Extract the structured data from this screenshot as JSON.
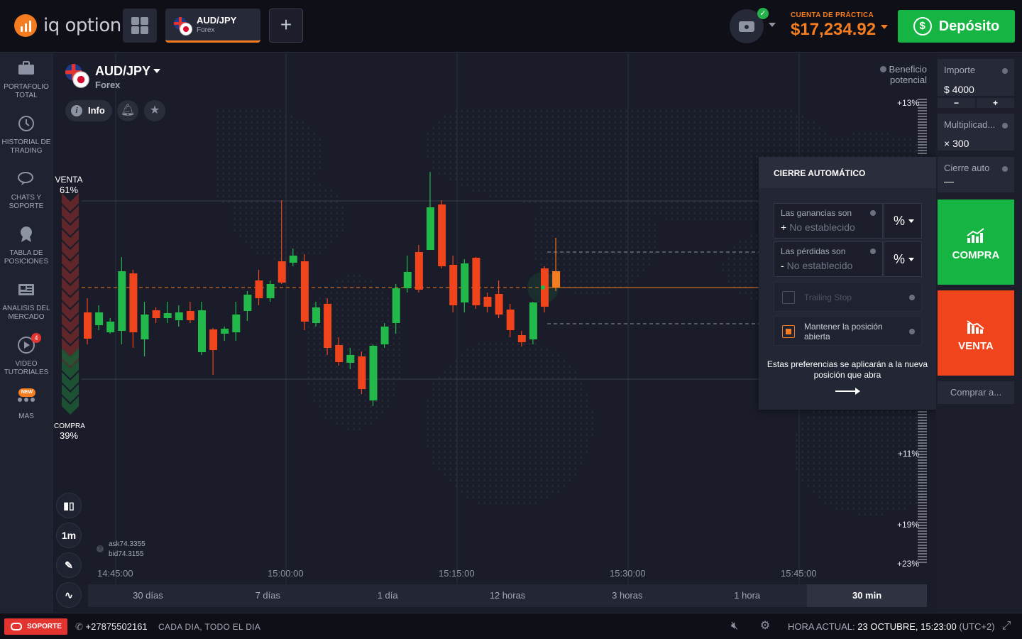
{
  "header": {
    "logo_text": "iq option",
    "asset_tab": {
      "name": "AUD/JPY",
      "type": "Forex"
    },
    "add_tab_label": "+",
    "account_label": "CUENTA DE PRÁCTICA",
    "balance": "$17,234.92",
    "deposit_label": "Depósito"
  },
  "sidebar": {
    "items": [
      {
        "label": "PORTAFOLIO TOTAL",
        "icon": "briefcase-icon"
      },
      {
        "label": "HISTORIAL DE TRADING",
        "icon": "history-icon"
      },
      {
        "label": "CHATS Y SOPORTE",
        "icon": "chat-icon"
      },
      {
        "label": "TABLA DE POSICIONES",
        "icon": "trophy-icon"
      },
      {
        "label": "ANALISIS DEL MERCADO",
        "icon": "news-icon"
      },
      {
        "label": "VIDEO TUTORIALES",
        "icon": "play-icon",
        "badge": "4"
      },
      {
        "label": "MAS",
        "icon": "more-icon",
        "badge": "NEW"
      }
    ]
  },
  "chart_header": {
    "asset": "AUD/JPY",
    "type": "Forex",
    "info_label": "Info"
  },
  "sentiment": {
    "sell_label": "VENTA",
    "sell_pct": "61%",
    "buy_label": "COMPRA",
    "buy_pct": "39%"
  },
  "tools": {
    "timeframe": "1m"
  },
  "quotes": {
    "ask": "ask74.3355",
    "bid": "bid74.3155"
  },
  "time_labels": [
    "14:45:00",
    "15:00:00",
    "15:15:00",
    "15:30:00",
    "15:45:00"
  ],
  "ranges": [
    {
      "label": "30 días",
      "active": false
    },
    {
      "label": "7 días",
      "active": false
    },
    {
      "label": "1 día",
      "active": false
    },
    {
      "label": "12 horas",
      "active": false
    },
    {
      "label": "3 horas",
      "active": false
    },
    {
      "label": "1 hora",
      "active": false
    },
    {
      "label": "30 min",
      "active": true
    }
  ],
  "profit": {
    "label": "Beneficio potencial",
    "scale": [
      "+13%",
      "+11%",
      "+19%",
      "+23%"
    ]
  },
  "auto_close": {
    "title": "CIERRE AUTOMÁTICO",
    "profit_label": "Las ganancias son",
    "profit_sign": "+",
    "profit_value": "No establecido",
    "profit_unit": "%",
    "loss_label": "Las pérdidas son",
    "loss_sign": "-",
    "loss_value": "No establecido",
    "loss_unit": "%",
    "trailing_label": "Trailing Stop",
    "trailing_checked": false,
    "keep_label": "Mantener la posición abierta",
    "keep_checked": true,
    "note": "Estas preferencias se aplicarán a la nueva posición que abra"
  },
  "trade_panel": {
    "amount_label": "Importe",
    "amount_value": "$  4000",
    "minus": "−",
    "plus": "+",
    "multiplier_label": "Multiplicad...",
    "multiplier_value": "× 300",
    "auto_close_label": "Cierre auto",
    "auto_close_value": "—",
    "buy_label": "COMPRA",
    "sell_label": "VENTA",
    "buy_at_label": "Comprar a..."
  },
  "footer": {
    "support_label": "SOPORTE",
    "phone": "+27875502161",
    "hours": "CADA DIA, TODO EL DIA",
    "time_label": "HORA ACTUAL:",
    "time_value": "23 OCTUBRE, 15:23:00",
    "tz": "(UTC+2)"
  },
  "chart_data": {
    "type": "candlestick",
    "colors": {
      "up": "#22b84a",
      "down": "#f0441c",
      "current": "#f57c1f"
    },
    "x": [
      "14:45:00",
      "15:00:00",
      "15:15:00",
      "15:30:00",
      "15:45:00"
    ],
    "current_price_marker": true,
    "candles_relative": [
      [
        440,
        477,
        420,
        485
      ],
      [
        458,
        440,
        430,
        465
      ],
      [
        468,
        453,
        448,
        470
      ],
      [
        466,
        382,
        362,
        485
      ],
      [
        385,
        468,
        380,
        490
      ],
      [
        478,
        443,
        425,
        502
      ],
      [
        437,
        448,
        433,
        455
      ],
      [
        448,
        441,
        425,
        455
      ],
      [
        451,
        440,
        430,
        460
      ],
      [
        438,
        451,
        425,
        455
      ],
      [
        496,
        437,
        425,
        500
      ],
      [
        464,
        493,
        462,
        528
      ],
      [
        470,
        463,
        460,
        480
      ],
      [
        468,
        443,
        425,
        480
      ],
      [
        438,
        415,
        410,
        452
      ],
      [
        395,
        420,
        380,
        430
      ],
      [
        420,
        400,
        395,
        425
      ],
      [
        368,
        398,
        282,
        400
      ],
      [
        370,
        360,
        350,
        375
      ],
      [
        368,
        453,
        358,
        465
      ],
      [
        455,
        433,
        425,
        460
      ],
      [
        428,
        490,
        420,
        500
      ],
      [
        486,
        510,
        475,
        515
      ],
      [
        511,
        500,
        490,
        520
      ],
      [
        502,
        548,
        495,
        555
      ],
      [
        564,
        487,
        485,
        572
      ],
      [
        485,
        460,
        455,
        490
      ],
      [
        455,
        406,
        400,
        470
      ],
      [
        406,
        383,
        360,
        412
      ],
      [
        355,
        408,
        345,
        412
      ],
      [
        352,
        292,
        242,
        352
      ],
      [
        288,
        375,
        282,
        378
      ],
      [
        373,
        430,
        360,
        440
      ],
      [
        426,
        371,
        365,
        440
      ],
      [
        363,
        430,
        362,
        435
      ],
      [
        418,
        432,
        412,
        440
      ],
      [
        414,
        443,
        395,
        448
      ],
      [
        436,
        465,
        428,
        475
      ],
      [
        472,
        482,
        466,
        488
      ],
      [
        478,
        426,
        425,
        485
      ],
      [
        378,
        432,
        375,
        440
      ],
      [
        382,
        405,
        335,
        410
      ]
    ]
  }
}
